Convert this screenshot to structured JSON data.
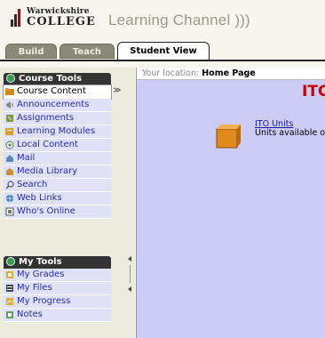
{
  "brand": {
    "line1": "Warwickshire",
    "line2": "COLLEGE",
    "channel": "Learning Channel )))"
  },
  "tabs": [
    {
      "label": "Build",
      "active": false
    },
    {
      "label": "Teach",
      "active": false
    },
    {
      "label": "Student View",
      "active": true
    }
  ],
  "course_tools": {
    "heading": "Course Tools",
    "items": [
      {
        "label": "Course Content",
        "icon": "folder-icon",
        "selected": true
      },
      {
        "label": "Announcements",
        "icon": "megaphone-icon"
      },
      {
        "label": "Assignments",
        "icon": "assignment-icon"
      },
      {
        "label": "Learning Modules",
        "icon": "module-icon"
      },
      {
        "label": "Local Content",
        "icon": "local-content-icon"
      },
      {
        "label": "Mail",
        "icon": "mail-icon"
      },
      {
        "label": "Media Library",
        "icon": "media-icon"
      },
      {
        "label": "Search",
        "icon": "search-icon"
      },
      {
        "label": "Web Links",
        "icon": "web-link-icon"
      },
      {
        "label": "Who's Online",
        "icon": "online-icon"
      }
    ]
  },
  "my_tools": {
    "heading": "My Tools",
    "items": [
      {
        "label": "My Grades",
        "icon": "grades-icon"
      },
      {
        "label": "My Files",
        "icon": "files-icon"
      },
      {
        "label": "My Progress",
        "icon": "progress-icon"
      },
      {
        "label": "Notes",
        "icon": "notes-icon"
      }
    ]
  },
  "location": {
    "prefix": "Your location:",
    "current": "Home Page"
  },
  "main": {
    "title": "ITC",
    "unit_link": "ITO Units",
    "unit_desc": "Units available o"
  },
  "colors": {
    "content_bg": "#ccccf6",
    "title_red": "#cc0000",
    "link_blue": "#1a1aa0",
    "menu_bg": "#dfe2f6"
  }
}
